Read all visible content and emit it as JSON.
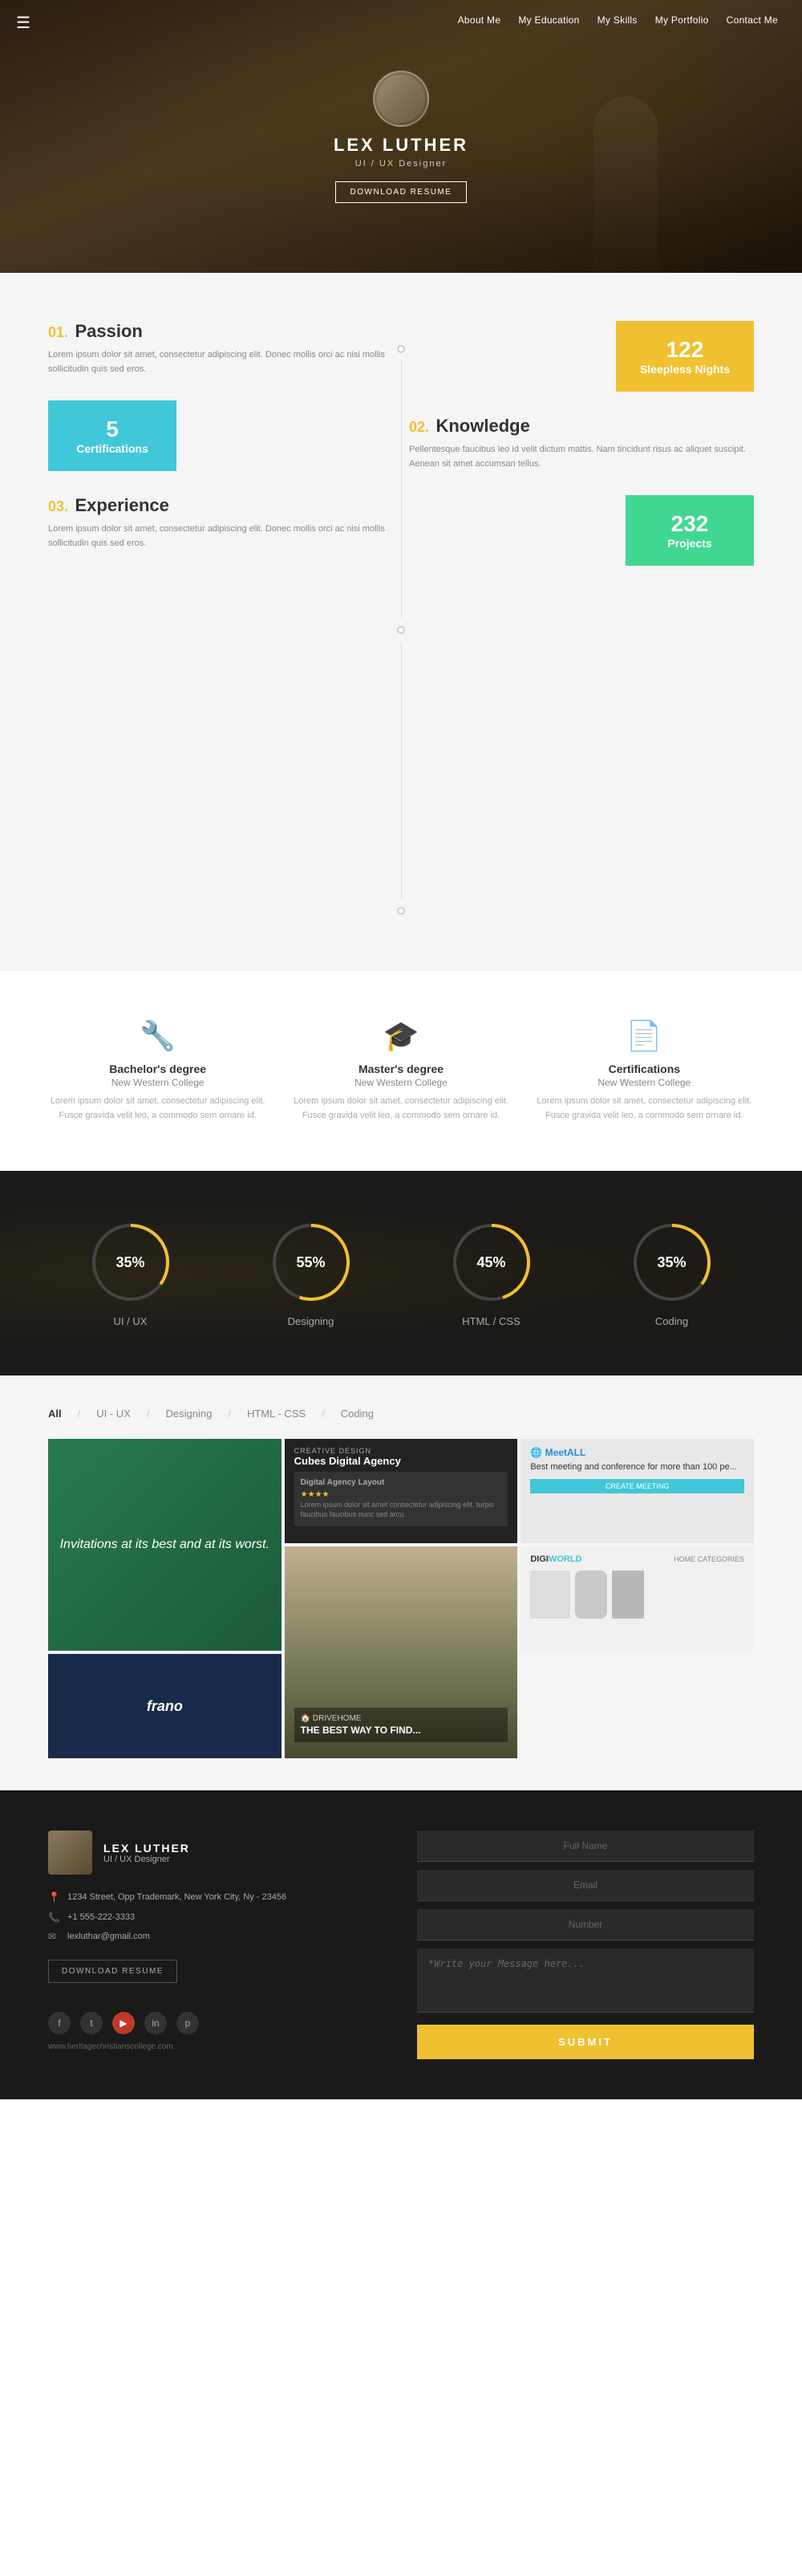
{
  "nav": {
    "items": [
      "About Me",
      "My Education",
      "My Skills",
      "My Portfolio",
      "Contact Me"
    ]
  },
  "hero": {
    "name": "LEX LUTHER",
    "title": "UI / UX Designer",
    "download_btn": "DOWNLOAD RESUME"
  },
  "about": {
    "passion": {
      "num": "01.",
      "title": "Passion",
      "text": "Lorem ipsum dolor sit amet, consectetur adipiscing elit. Donec mollis orci ac nisi mollis sollicitudin quis sed eros."
    },
    "knowledge": {
      "num": "02.",
      "title": "Knowledge",
      "text": "Pellentesque faucibus leo id velit dictum mattis. Nam tincidunt risus ac aliquet suscipit. Aenean sit amet accumsan tellus."
    },
    "experience": {
      "num": "03.",
      "title": "Experience",
      "text": "Lorem ipsum dolor sit amet, consectetur adipiscing elit. Donec mollis orci ac nisi mollis sollicitudin quis sed eros."
    },
    "stat1_number": "122",
    "stat1_label": "Sleepless Nights",
    "stat2_number": "5",
    "stat2_label": "Certifications",
    "stat3_number": "232",
    "stat3_label": "Projects"
  },
  "education": {
    "items": [
      {
        "degree": "Bachelor's degree",
        "school": "New Western College",
        "text": "Lorem ipsum dolor sit amet, consectetur adipiscing elit. Fusce gravida velit leo, a commodo sem ornare id."
      },
      {
        "degree": "Master's degree",
        "school": "New Western College",
        "text": "Lorem ipsum dolor sit amet, consectetur adipiscing elit. Fusce gravida velit leo, a commodo sem ornare id."
      },
      {
        "degree": "Certifications",
        "school": "New Western College",
        "text": "Lorem ipsum dolor sit amet, consectetur adipiscing elit. Fusce gravida velit leo, a commodo sem ornare id."
      }
    ]
  },
  "skills": {
    "items": [
      {
        "name": "UI / UX",
        "percent": 35,
        "color": "#f0c030"
      },
      {
        "name": "Designing",
        "percent": 55,
        "color": "#f0c030"
      },
      {
        "name": "HTML / CSS",
        "percent": 45,
        "color": "#f0c030"
      },
      {
        "name": "Coding",
        "percent": 35,
        "color": "#f0c030"
      }
    ]
  },
  "portfolio": {
    "filter": [
      "All",
      "UI - UX",
      "Designing",
      "HTML - CSS",
      "Coding"
    ],
    "items": [
      {
        "type": "green",
        "italic_text": "Invitations at its best and at its worst.",
        "tag": "",
        "title": ""
      },
      {
        "type": "dark_agency",
        "tag": "CREATIVE DESIGN",
        "title": "Cubes Digital Agency",
        "subtitle": "Digital Agency Layout",
        "stars": "★★★★",
        "desc": "Lorem ipsum dolor sit amet consectetur adipiscing elit. turpis faucibus faucibus nunc sed arcu."
      },
      {
        "type": "meet",
        "logo": "MeetALL",
        "desc": "Best meeting and conference for more than 100 pe...",
        "btn": "CREATE MEETING"
      },
      {
        "type": "cityscape",
        "headline": "THE BEST WAY TO FIND...",
        "tag": ""
      },
      {
        "type": "digi",
        "logo": "DIGIWORLD",
        "nav": "HOME  CATEGORIES"
      },
      {
        "type": "frano",
        "text": "frano"
      }
    ]
  },
  "contact": {
    "name": "LEX LUTHER",
    "role": "UI / UX Designer",
    "address": "1234 Street, Opp Trademark,\nNew York City, Ny - 23456",
    "phone": "+1 555-222-3333",
    "email": "lexluthar@gmail.com",
    "download_btn": "DOWNLOAD RESUME",
    "website": "www.heritagechristianscollege.com",
    "form": {
      "full_name_placeholder": "Full Name",
      "email_placeholder": "Email",
      "number_placeholder": "Number",
      "message_placeholder": "*Write your Message here...",
      "submit_btn": "SUBMIT"
    }
  }
}
